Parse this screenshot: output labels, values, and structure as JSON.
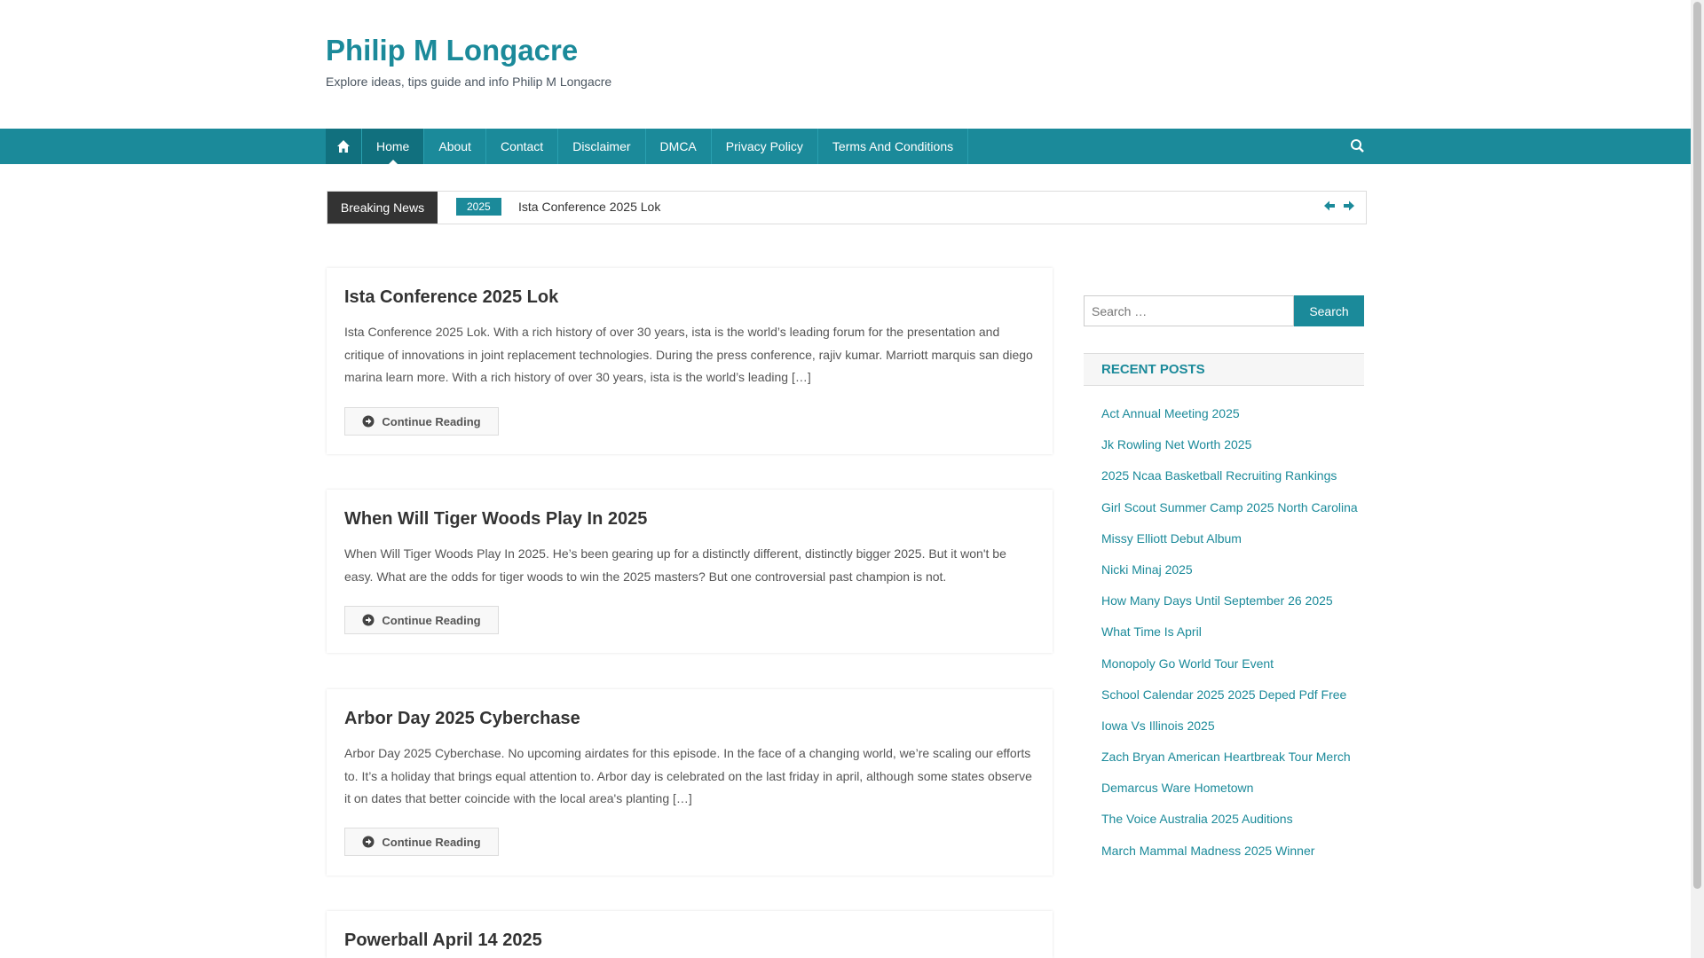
{
  "site": {
    "title": "Philip M Longacre",
    "tagline": "Explore ideas, tips guide and info Philip M Longacre"
  },
  "nav": {
    "items": [
      "Home",
      "About",
      "Contact",
      "Disclaimer",
      "DMCA",
      "Privacy Policy",
      "Terms And Conditions"
    ]
  },
  "breaking": {
    "label": "Breaking News",
    "tag": "2025",
    "headline": "Ista Conference 2025 Lok"
  },
  "posts": [
    {
      "title": "Ista Conference 2025 Lok",
      "excerpt": "Ista Conference 2025 Lok. With a rich history of over 30 years, ista is the world’s leading forum for the presentation and critique of innovations in joint replacement technologies. During the press conference, rajiv kumar. Marriott marquis san diego marina learn more. With a rich history of over 30 years, ista is the world’s leading […]",
      "button": "Continue Reading"
    },
    {
      "title": "When Will Tiger Woods Play In 2025",
      "excerpt": "When Will Tiger Woods Play In 2025. He’s been gearing up for a distinctly different, distinctly bigger 2025. But it won't be easy. What are the odds for tiger woods to win the 2025 masters? But one controversial past champion is not.",
      "button": "Continue Reading"
    },
    {
      "title": "Arbor Day 2025 Cyberchase",
      "excerpt": "Arbor Day 2025 Cyberchase. No upcoming airdates for this episode. In the face of a changing world, we’re scaling our efforts to. It’s a holiday that brings equal attention to. Arbor day is celebrated on the last friday in april, although some states observe it on dates that better coincide with the local area's planting […]",
      "button": "Continue Reading"
    },
    {
      "title": "Powerball April 14 2025"
    }
  ],
  "sidebar": {
    "search_placeholder": "Search …",
    "search_button": "Search",
    "recent_title": "RECENT POSTS",
    "recent": [
      "Act Annual Meeting 2025",
      "Jk Rowling Net Worth 2025",
      "2025 Ncaa Basketball Recruiting Rankings",
      "Girl Scout Summer Camp 2025 North Carolina",
      "Missy Elliott Debut Album",
      "Nicki Minaj 2025",
      "How Many Days Until September 26 2025",
      "What Time Is April",
      "Monopoly Go World Tour Event",
      "School Calendar 2025 2025 Deped Pdf Free",
      "Iowa Vs Illinois 2025",
      "Zach Bryan American Heartbreak Tour Merch",
      "Demarcus Ware Hometown",
      "The Voice Australia 2025 Auditions",
      "March Mammal Madness 2025 Winner"
    ]
  },
  "colors": {
    "accent": "#1b8a9a",
    "accent_dark": "#11707e"
  }
}
